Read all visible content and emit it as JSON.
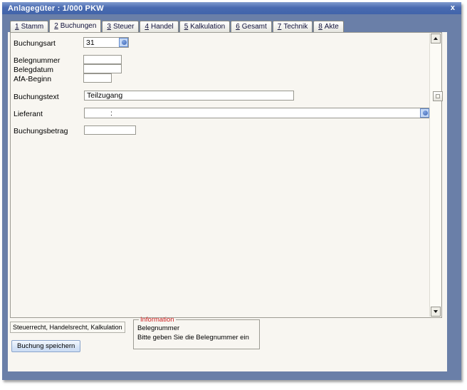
{
  "window": {
    "title": "Anlagegüter : 1/000 PKW",
    "close_glyph": "x"
  },
  "tabs": [
    {
      "number": "1",
      "label": "Stamm",
      "active": false
    },
    {
      "number": "2",
      "label": "Buchungen",
      "active": true
    },
    {
      "number": "3",
      "label": "Steuer",
      "active": false
    },
    {
      "number": "4",
      "label": "Handel",
      "active": false
    },
    {
      "number": "5",
      "label": "Kalkulation",
      "active": false
    },
    {
      "number": "6",
      "label": "Gesamt",
      "active": false
    },
    {
      "number": "7",
      "label": "Technik",
      "active": false
    },
    {
      "number": "8",
      "label": "Akte",
      "active": false
    }
  ],
  "form": {
    "buchungsart": {
      "label": "Buchungsart",
      "value": "31"
    },
    "belegnummer": {
      "label": "Belegnummer",
      "value": ""
    },
    "belegdatum": {
      "label": "Belegdatum",
      "value": ""
    },
    "afa_beginn": {
      "label": "AfA-Beginn",
      "value": ""
    },
    "buchungstext": {
      "label": "Buchungstext",
      "value": "Teilzugang"
    },
    "lieferant": {
      "label": "Lieferant",
      "value": ":"
    },
    "buchungsbetrag": {
      "label": "Buchungsbetrag",
      "value": ""
    }
  },
  "footer": {
    "scope_text": "Steuerrecht, Handelsrecht, Kalkulation",
    "save_button": "Buchung speichern",
    "info": {
      "title": "Information",
      "lines": [
        "Belegnummer",
        "Bitte geben Sie die Belegnummer ein"
      ]
    }
  },
  "colors": {
    "titlebar_blue": "#4a6bb1",
    "frame_blue": "#6a7fa8",
    "panel_bg": "#f8f6f1",
    "info_title_red": "#cc2222",
    "combo_button_blue": "#c6d9f5"
  }
}
